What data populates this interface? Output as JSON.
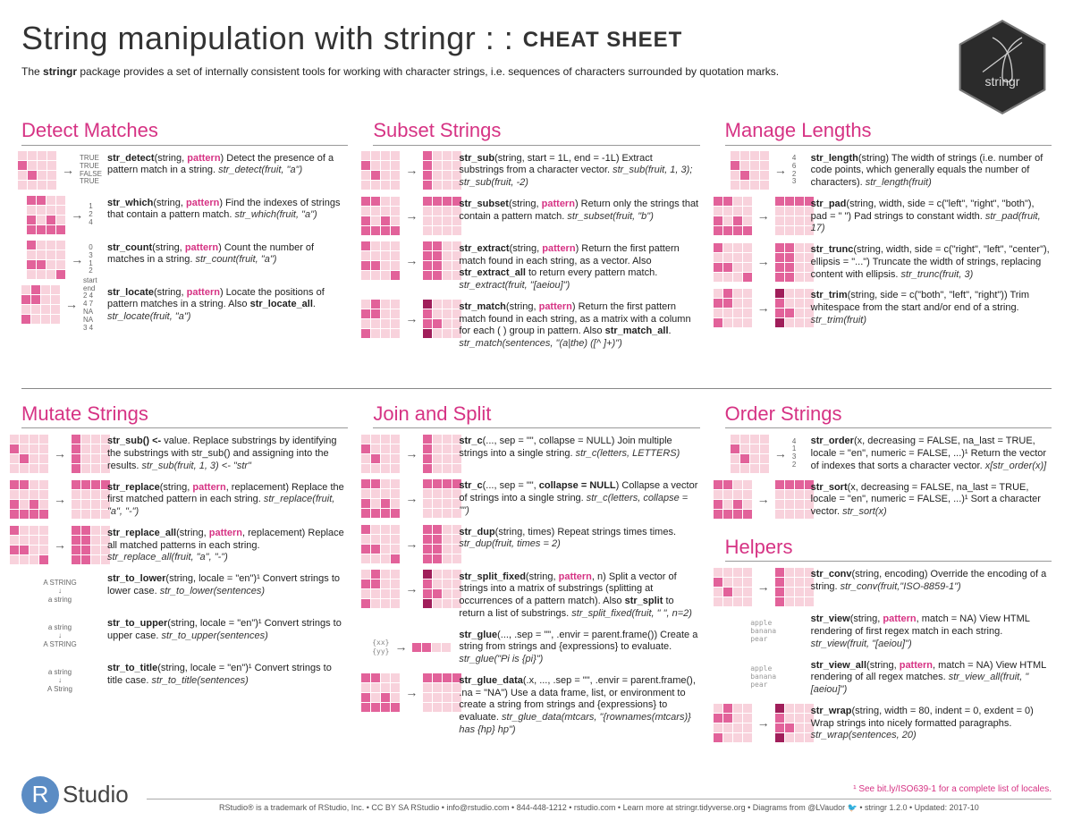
{
  "header": {
    "title_left": "String manipulation with stringr : :",
    "title_right": "CHEAT SHEET",
    "intro_pre": "The ",
    "intro_bold": "stringr",
    "intro_post": " package provides a set of internally consistent tools for working with character strings, i.e. sequences of characters surrounded by quotation marks.",
    "hex_label": "stringr"
  },
  "col1_top": {
    "title": "Detect Matches",
    "entries": [
      {
        "thumb_out": [
          "TRUE",
          "TRUE",
          "FALSE",
          "TRUE"
        ],
        "fn": "str_detect",
        "sig": "(string, ",
        "kw": "pattern",
        "sig2": ") Detect the presence of a pattern match in a string.",
        "ex": "str_detect(fruit, \"a\")"
      },
      {
        "thumb_out": [
          "1",
          "2",
          "4"
        ],
        "fn": "str_which",
        "sig": "(string, ",
        "kw": "pattern",
        "sig2": ") Find the indexes of strings that contain a pattern match.",
        "ex": "str_which(fruit, \"a\")"
      },
      {
        "thumb_out": [
          "0",
          "3",
          "1",
          "2"
        ],
        "fn": "str_count",
        "sig": "(string, ",
        "kw": "pattern",
        "sig2": ") Count the number of matches in a string.",
        "ex": "str_count(fruit, \"a\")"
      },
      {
        "thumb_out": [
          "start end",
          "2  4",
          "4  7",
          "NA NA",
          "3  4"
        ],
        "fn": "str_locate",
        "sig": "(string, ",
        "kw": "pattern",
        "sig2": ") Locate the positions of pattern matches in a string. Also ",
        "bold2": "str_locate_all",
        "sig3": ".",
        "ex": "str_locate(fruit, \"a\")"
      }
    ]
  },
  "col2_top": {
    "title": "Subset Strings",
    "entries": [
      {
        "fn": "str_sub",
        "sig": "(string, start = 1L, end = -1L) Extract substrings from a character vector.",
        "ex": "str_sub(fruit, 1, 3); str_sub(fruit, -2)"
      },
      {
        "fn": "str_subset",
        "sig": "(string, ",
        "kw": "pattern",
        "sig2": ") Return only the strings that contain a pattern match.",
        "ex": "str_subset(fruit, \"b\")"
      },
      {
        "fn": "str_extract",
        "sig": "(string, ",
        "kw": "pattern",
        "sig2": ") Return the first pattern match found in each string, as a vector. Also ",
        "bold2": "str_extract_all",
        "sig3": " to return every pattern match.",
        "ex": "str_extract(fruit, \"[aeiou]\")"
      },
      {
        "fn": "str_match",
        "sig": "(string, ",
        "kw": "pattern",
        "sig2": ") Return the first pattern match found in each string, as a matrix with a column for each ( ) group in pattern. Also ",
        "bold2": "str_match_all",
        "sig3": ".",
        "ex": "str_match(sentences, \"(a|the) ([^ ]+)\")"
      }
    ]
  },
  "col3_top": {
    "title": "Manage Lengths",
    "entries": [
      {
        "thumb_out": [
          "4",
          "6",
          "2",
          "3"
        ],
        "fn": "str_length",
        "sig": "(string) The width of strings (i.e. number of code points, which generally equals the number of characters).",
        "ex": "str_length(fruit)"
      },
      {
        "fn": "str_pad",
        "sig": "(string, width, side = c(\"left\", \"right\", \"both\"), pad = \" \") Pad strings to constant width.",
        "ex": "str_pad(fruit, 17)"
      },
      {
        "fn": "str_trunc",
        "sig": "(string, width, side = c(\"right\", \"left\", \"center\"), ellipsis = \"...\") Truncate the width of strings, replacing content with ellipsis.",
        "ex": "str_trunc(fruit, 3)"
      },
      {
        "fn": "str_trim",
        "sig": "(string, side = c(\"both\", \"left\", \"right\")) Trim whitespace from the start and/or end of a string.",
        "ex": "str_trim(fruit)"
      }
    ]
  },
  "col1_bot": {
    "title": "Mutate Strings",
    "entries": [
      {
        "fn": "str_sub() <-",
        "sig": " value. Replace substrings by identifying the substrings with str_sub() and assigning into the results.",
        "ex": "str_sub(fruit, 1, 3) <- \"str\""
      },
      {
        "fn": "str_replace",
        "sig": "(string, ",
        "kw": "pattern",
        "sig2": ", replacement) Replace the first matched pattern in each string.",
        "ex": "str_replace(fruit, \"a\", \"-\")"
      },
      {
        "fn": "str_replace_all",
        "sig": "(string, ",
        "kw": "pattern",
        "sig2": ", replacement) Replace all matched patterns in each string.",
        "ex": "str_replace_all(fruit, \"a\", \"-\")"
      },
      {
        "case_from": "A STRING",
        "case_to": "a string",
        "fn": "str_to_lower",
        "sig": "(string, locale = \"en\")¹ Convert strings to lower case.",
        "ex": "str_to_lower(sentences)"
      },
      {
        "case_from": "a string",
        "case_to": "A STRING",
        "fn": "str_to_upper",
        "sig": "(string, locale = \"en\")¹ Convert strings to upper case.",
        "ex": "str_to_upper(sentences)"
      },
      {
        "case_from": "a string",
        "case_to": "A String",
        "fn": "str_to_title",
        "sig": "(string, locale = \"en\")¹ Convert strings to title case.",
        "ex": "str_to_title(sentences)"
      }
    ]
  },
  "col2_bot": {
    "title": "Join and Split",
    "entries": [
      {
        "fn": "str_c",
        "sig": "(..., sep = \"\", collapse = NULL) Join multiple strings into a single string.",
        "ex": "str_c(letters, LETTERS)"
      },
      {
        "fn": "str_c",
        "sig": "(..., sep = \"\", ",
        "bold2": "collapse = NULL",
        "sig3": ") Collapse a vector of strings into a single string.",
        "ex": "str_c(letters, collapse = \"\")"
      },
      {
        "fn": "str_dup",
        "sig": "(string, times) Repeat strings times times.",
        "ex": "str_dup(fruit, times = 2)"
      },
      {
        "fn": "str_split_fixed",
        "sig": "(string, ",
        "kw": "pattern",
        "sig2": ", n) Split a vector of strings into a matrix of substrings (splitting at occurrences of a pattern match). Also ",
        "bold2": "str_split",
        "sig3": " to return a list of substrings.",
        "ex": "str_split_fixed(fruit, \" \", n=2)"
      },
      {
        "glue": "{xx}  {yy}",
        "fn": "str_glue",
        "sig": "(..., .sep = \"\", .envir = parent.frame()) Create a string from strings and {expressions} to evaluate.",
        "ex": "str_glue(\"Pi is {pi}\")"
      },
      {
        "fn": "str_glue_data",
        "sig": "(.x, ..., .sep = \"\", .envir = parent.frame(), .na = \"NA\") Use a data frame, list, or environment to create a string from strings and {expressions} to evaluate.",
        "ex": "str_glue_data(mtcars, \"{rownames(mtcars)} has {hp} hp\")"
      }
    ]
  },
  "col3_bot_a": {
    "title": "Order Strings",
    "entries": [
      {
        "thumb_out": [
          "4",
          "1",
          "3",
          "2"
        ],
        "fn": "str_order",
        "sig": "(x, decreasing = FALSE, na_last = TRUE, locale = \"en\", numeric = FALSE, ...)¹ Return the vector of indexes that sorts a character vector.",
        "ex": "x[str_order(x)]"
      },
      {
        "fn": "str_sort",
        "sig": "(x, decreasing = FALSE, na_last = TRUE, locale = \"en\", numeric = FALSE, ...)¹ Sort a character vector.",
        "ex": "str_sort(x)"
      }
    ]
  },
  "col3_bot_b": {
    "title": "Helpers",
    "entries": [
      {
        "fn": "str_conv",
        "sig": "(string, encoding) Override the encoding of a string.",
        "ex": "str_conv(fruit,\"ISO-8859-1\")"
      },
      {
        "list": [
          "apple",
          "banana",
          "pear"
        ],
        "fn": "str_view",
        "sig": "(string, ",
        "kw": "pattern",
        "sig2": ", match = NA) View HTML rendering of first regex match in each string.",
        "ex": "str_view(fruit, \"[aeiou]\")"
      },
      {
        "list": [
          "apple",
          "banana",
          "pear"
        ],
        "fn": "str_view_all",
        "sig": "(string, ",
        "kw": "pattern",
        "sig2": ", match = NA) View HTML rendering of all regex matches.",
        "ex": "str_view_all(fruit, \"[aeiou]\")"
      },
      {
        "fn": "str_wrap",
        "sig": "(string, width = 80, indent = 0, exdent = 0) Wrap strings into nicely formatted paragraphs.",
        "ex": "str_wrap(sentences, 20)"
      }
    ]
  },
  "footer": {
    "studio": "Studio",
    "note": "¹ See bit.ly/ISO639-1 for a complete list of locales.",
    "line": "RStudio® is a trademark of RStudio, Inc.  •  CC BY SA RStudio •  info@rstudio.com  •  844-448-1212 •  rstudio.com •  Learn more at stringr.tidyverse.org •  Diagrams from @LVaudor 🐦 • stringr  1.2.0 •   Updated: 2017-10"
  }
}
